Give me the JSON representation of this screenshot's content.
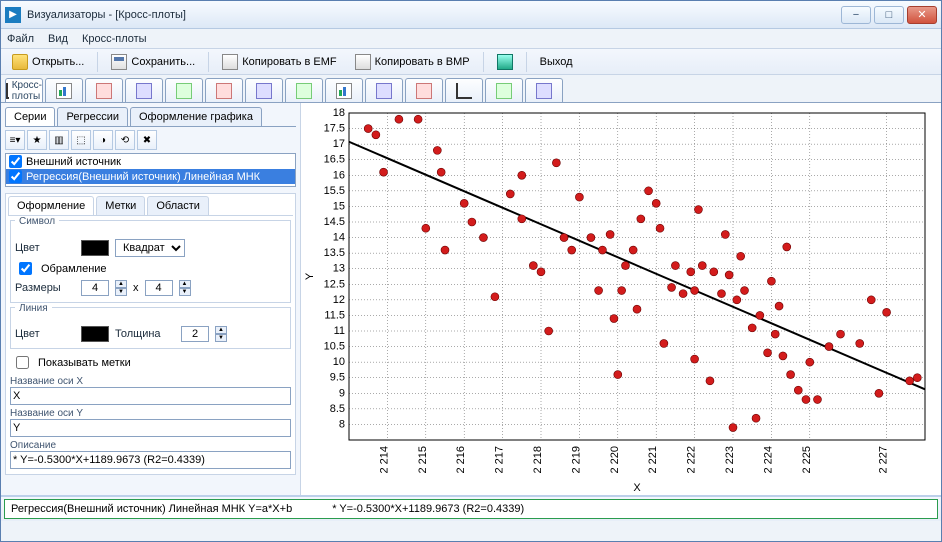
{
  "window": {
    "title": "Визуализаторы - [Кросс-плоты]",
    "controls": {
      "min": "−",
      "max": "□",
      "close": "✕"
    }
  },
  "menu": [
    "Файл",
    "Вид",
    "Кросс-плоты"
  ],
  "toolbar1": [
    {
      "id": "open",
      "label": "Открыть...",
      "icon": "ic-folder"
    },
    {
      "id": "save",
      "label": "Сохранить...",
      "icon": "ic-save"
    },
    {
      "id": "copyemf",
      "label": "Копировать в EMF",
      "icon": "ic-copy"
    },
    {
      "id": "copybmp",
      "label": "Копировать в BMP",
      "icon": "ic-copy"
    },
    {
      "id": "exitmarker",
      "label": "",
      "icon": "ic-exit"
    },
    {
      "id": "exit",
      "label": "Выход",
      "icon": ""
    }
  ],
  "icon_tabs": {
    "main_label": "Кросс-плоты"
  },
  "left": {
    "subtabs": [
      "Серии",
      "Регрессии",
      "Оформление графика"
    ],
    "subtab_active": 0,
    "sources": [
      {
        "name": "Внешний источник",
        "checked": true,
        "selected": false
      },
      {
        "name": "Регрессия(Внешний источник) Линейная МНК",
        "checked": true,
        "selected": true
      }
    ],
    "prop_tabs": [
      "Оформление",
      "Метки",
      "Области"
    ],
    "prop_tab_active": 0,
    "symbol": {
      "group_title": "Символ",
      "color_label": "Цвет",
      "color": "#000000",
      "shape_select": "Квадрат",
      "border_check": true,
      "border_label": "Обрамление",
      "size_label": "Размеры",
      "size_w": "4",
      "size_h": "4",
      "size_sep": "x"
    },
    "line": {
      "group_title": "Линия",
      "color_label": "Цвет",
      "color": "#000000",
      "thickness_label": "Толщина",
      "thickness": "2"
    },
    "show_labels": {
      "checked": false,
      "label": "Показывать метки"
    },
    "axis_x": {
      "title": "Название оси X",
      "value": "X"
    },
    "axis_y": {
      "title": "Название оси Y",
      "value": "Y"
    },
    "description": {
      "title": "Описание",
      "value": "* Y=-0.5300*X+1189.9673 (R2=0.4339)"
    }
  },
  "status": {
    "left_text": "Регрессия(Внешний источник) Линейная МНК Y=a*X+b",
    "right_text": "* Y=-0.5300*X+1189.9673 (R2=0.4339)"
  },
  "chart_data": {
    "type": "scatter",
    "xlabel": "X",
    "ylabel": "Y",
    "xlim": [
      2213,
      2228
    ],
    "ylim": [
      7.5,
      18
    ],
    "x_ticks": [
      2214,
      2215,
      2216,
      2217,
      2218,
      2219,
      2220,
      2221,
      2222,
      2223,
      2224,
      2225,
      2227
    ],
    "x_tick_labels": [
      "2 214",
      "2 215",
      "2 216",
      "2 217",
      "2 218",
      "2 219",
      "2 220",
      "2 221",
      "2 222",
      "2 223",
      "2 224",
      "2 225",
      "2 227"
    ],
    "y_ticks": [
      8,
      8.5,
      9,
      9.5,
      10,
      10.5,
      11,
      11.5,
      12,
      12.5,
      13,
      13.5,
      14,
      14.5,
      15,
      15.5,
      16,
      16.5,
      17,
      17.5,
      18
    ],
    "regression": {
      "slope": -0.53,
      "intercept": 1189.9673,
      "r2": 0.4339
    },
    "series": [
      {
        "name": "Внешний источник",
        "color": "#d31c1c",
        "points": [
          [
            2213.5,
            17.5
          ],
          [
            2213.7,
            17.3
          ],
          [
            2213.9,
            16.1
          ],
          [
            2214.3,
            17.8
          ],
          [
            2214.8,
            17.8
          ],
          [
            2215.3,
            16.8
          ],
          [
            2215.4,
            16.1
          ],
          [
            2215.0,
            14.3
          ],
          [
            2215.5,
            13.6
          ],
          [
            2216.0,
            15.1
          ],
          [
            2216.2,
            14.5
          ],
          [
            2216.5,
            14.0
          ],
          [
            2216.8,
            12.1
          ],
          [
            2217.2,
            15.4
          ],
          [
            2217.5,
            14.6
          ],
          [
            2217.8,
            13.1
          ],
          [
            2218.0,
            12.9
          ],
          [
            2217.5,
            16.0
          ],
          [
            2218.6,
            14.0
          ],
          [
            2218.8,
            13.6
          ],
          [
            2218.4,
            16.4
          ],
          [
            2219.0,
            15.3
          ],
          [
            2218.2,
            11.0
          ],
          [
            2219.3,
            14.0
          ],
          [
            2219.6,
            13.6
          ],
          [
            2219.8,
            14.1
          ],
          [
            2219.5,
            12.3
          ],
          [
            2219.9,
            11.4
          ],
          [
            2220.2,
            13.1
          ],
          [
            2220.4,
            13.6
          ],
          [
            2220.6,
            14.6
          ],
          [
            2220.8,
            15.5
          ],
          [
            2220.1,
            12.3
          ],
          [
            2220.5,
            11.7
          ],
          [
            2220.0,
            9.6
          ],
          [
            2221.1,
            14.3
          ],
          [
            2221.4,
            12.4
          ],
          [
            2221.5,
            13.1
          ],
          [
            2221.7,
            12.2
          ],
          [
            2221.9,
            12.9
          ],
          [
            2221.2,
            10.6
          ],
          [
            2221.0,
            15.1
          ],
          [
            2222.0,
            12.3
          ],
          [
            2222.2,
            13.1
          ],
          [
            2222.5,
            12.9
          ],
          [
            2222.7,
            12.2
          ],
          [
            2222.9,
            12.8
          ],
          [
            2222.0,
            10.1
          ],
          [
            2222.4,
            9.4
          ],
          [
            2222.1,
            14.9
          ],
          [
            2222.8,
            14.1
          ],
          [
            2223.1,
            12.0
          ],
          [
            2223.3,
            12.3
          ],
          [
            2223.5,
            11.1
          ],
          [
            2223.7,
            11.5
          ],
          [
            2223.9,
            10.3
          ],
          [
            2223.2,
            13.4
          ],
          [
            2223.0,
            7.9
          ],
          [
            2223.6,
            8.2
          ],
          [
            2224.1,
            10.9
          ],
          [
            2224.3,
            10.2
          ],
          [
            2224.5,
            9.6
          ],
          [
            2224.7,
            9.1
          ],
          [
            2224.9,
            8.8
          ],
          [
            2224.0,
            12.6
          ],
          [
            2224.2,
            11.8
          ],
          [
            2224.4,
            13.7
          ],
          [
            2225.2,
            8.8
          ],
          [
            2225.0,
            10.0
          ],
          [
            2225.5,
            10.5
          ],
          [
            2225.8,
            10.9
          ],
          [
            2226.6,
            12.0
          ],
          [
            2226.8,
            9.0
          ],
          [
            2226.3,
            10.6
          ],
          [
            2227.0,
            11.6
          ],
          [
            2227.6,
            9.4
          ],
          [
            2227.8,
            9.5
          ]
        ]
      }
    ]
  }
}
